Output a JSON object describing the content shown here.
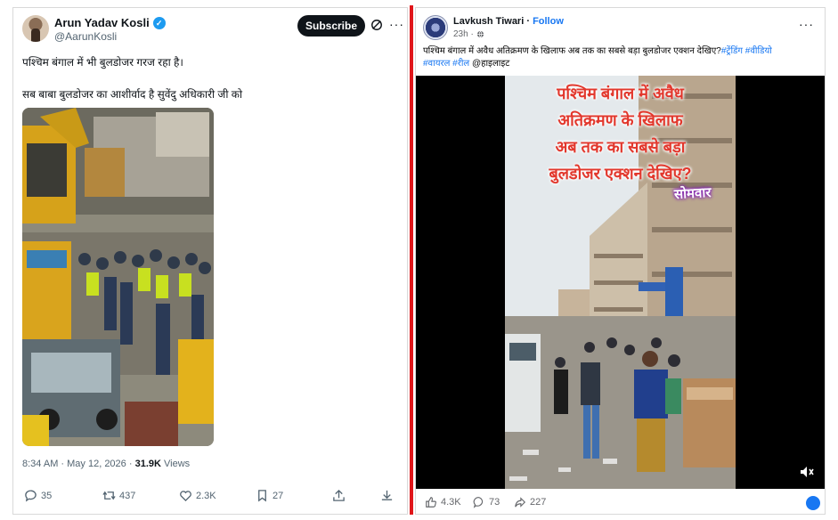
{
  "tweet": {
    "name": "Arun Yadav Kosli",
    "handle": "@AarunKosli",
    "subscribe_label": "Subscribe",
    "text_line1": "पश्चिम बंगाल में भी बुलडोजर गरज रहा है।",
    "text_line2": "सब बाबा बुलडोजर का आशीर्वाद है सुवेंदु अधिकारी जी को",
    "timestamp": "8:34 AM · May 12, 2026 · ",
    "views_count": "31.9K",
    "views_label": " Views",
    "replies": "35",
    "reposts": "437",
    "likes": "2.3K",
    "bookmarks": "27"
  },
  "facebook": {
    "name": "Lavkush Tiwari",
    "separator": " · ",
    "follow_label": "Follow",
    "time": "23h ·",
    "caption_text": "पश्चिम बंगाल में अवैध अतिक्रमण के खिलाफ अब तक का सबसे बड़ा बुलडोजर एक्शन देखिए?",
    "hashtags": [
      "#ट्रेंडिंग",
      "#वीडियो",
      "#वायरल",
      "#रील"
    ],
    "mention": "@हाइलाइट",
    "overlay_lines": [
      "पश्चिम बंगाल में अवैध",
      "अतिक्रमण के खिलाफ",
      "अब तक का सबसे बड़ा",
      "बुलडोजर एक्शन देखिए?"
    ],
    "overlay_tag": "सोमवार",
    "likes": "4.3K",
    "comments": "73",
    "shares": "227"
  },
  "colors": {
    "divider": "#e0161a",
    "x_blue": "#1d9bf0",
    "fb_blue": "#1877f2",
    "overlay_red": "#e2372c"
  }
}
